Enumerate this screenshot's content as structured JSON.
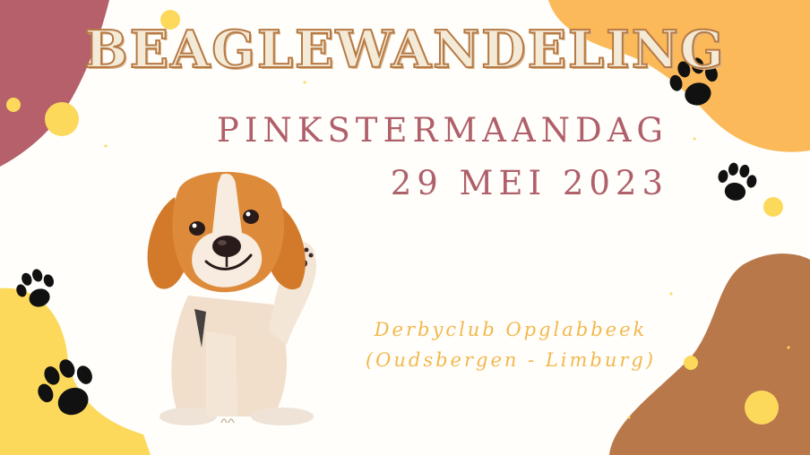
{
  "title": "BEAGLEWANDELING",
  "date_line_1": "PINKSTERMAANDAG",
  "date_line_2": "29 MEI 2023",
  "venue_line_1": "Derbyclub Opglabbeek",
  "venue_line_2": "(Oudsbergen - Limburg)",
  "illustration": "beagle-puppy-waving",
  "decorations": [
    "paw-print-icon",
    "paw-print-icon",
    "paw-print-icon",
    "paw-print-icon"
  ],
  "colors": {
    "title_fill": "#f3ead8",
    "title_outline": "#b77a44",
    "date_text": "#b0606a",
    "venue_text": "#f2b84d",
    "blob_rose": "#b5606a",
    "blob_orange": "#fbb95a",
    "blob_yellow": "#fcd95b",
    "blob_brown": "#b9784a"
  }
}
